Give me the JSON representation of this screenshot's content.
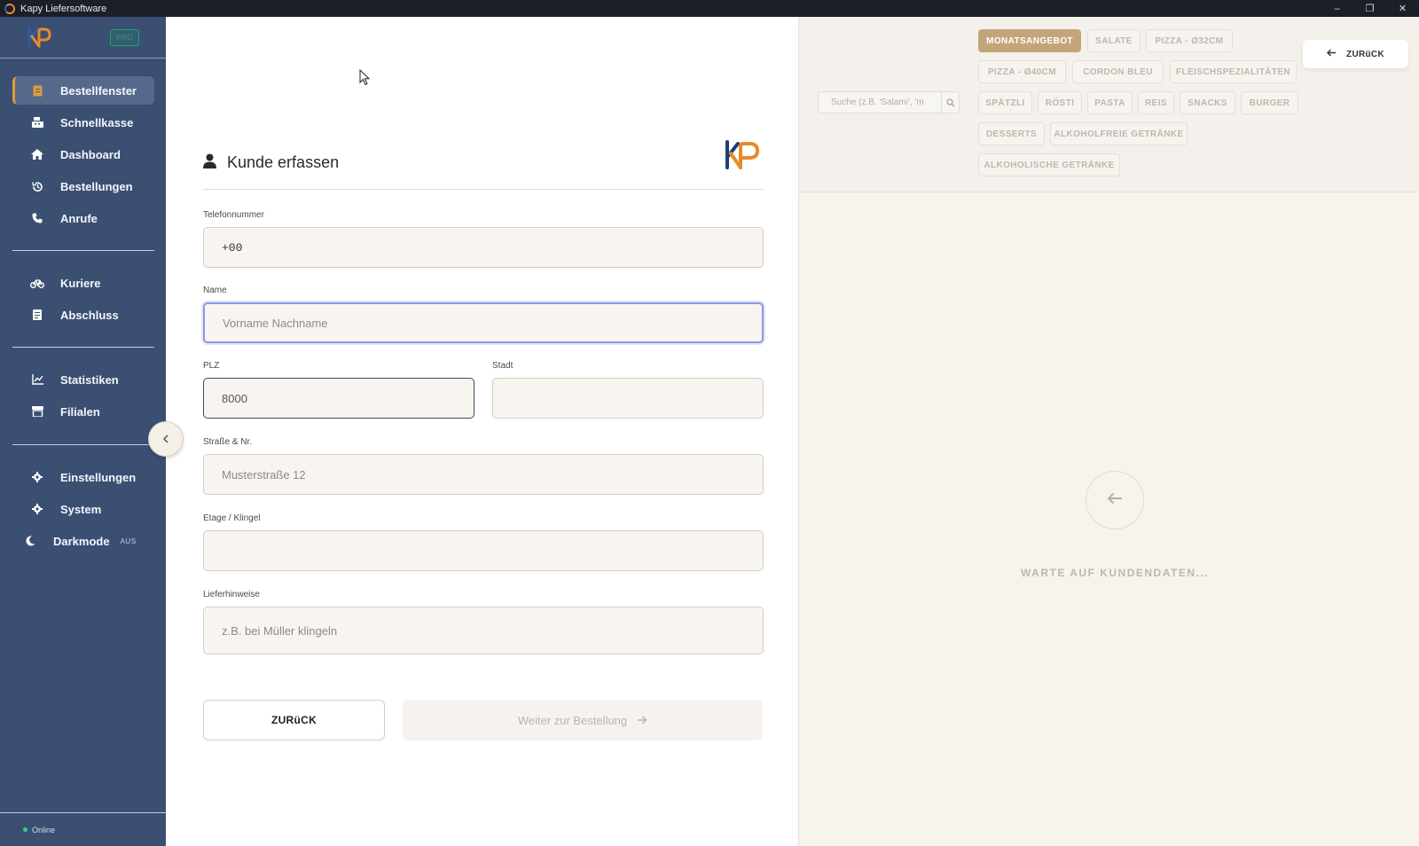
{
  "window": {
    "title": "Kapy Liefersoftware",
    "controls": [
      "–",
      "❐",
      "✕"
    ]
  },
  "sidebar": {
    "badge": "PRO",
    "items": [
      {
        "label": "Bestellfenster",
        "icon": "receipt-icon",
        "active": true
      },
      {
        "label": "Schnellkasse",
        "icon": "cash-register-icon"
      },
      {
        "label": "Dashboard",
        "icon": "home-icon"
      },
      {
        "label": "Bestellungen",
        "icon": "history-icon"
      },
      {
        "label": "Anrufe",
        "icon": "phone-icon"
      },
      {
        "label": "Kuriere",
        "icon": "bicycle-icon"
      },
      {
        "label": "Abschluss",
        "icon": "report-icon"
      },
      {
        "label": "Statistiken",
        "icon": "chart-line-icon"
      },
      {
        "label": "Filialen",
        "icon": "store-icon"
      },
      {
        "label": "Einstellungen",
        "icon": "gear-icon"
      },
      {
        "label": "System",
        "icon": "gear-icon"
      },
      {
        "label": "Darkmode",
        "icon": "moon-icon",
        "state": "AUS"
      }
    ],
    "status": "Online",
    "colors": {
      "background": "#3a4f72",
      "accent": "#e09a3a",
      "online": "#2bd67b"
    }
  },
  "form": {
    "title": "Kunde erfassen",
    "fields": {
      "phone": {
        "label": "Telefonnummer",
        "value": "+00"
      },
      "name": {
        "label": "Name",
        "placeholder": "Vorname Nachname"
      },
      "plz": {
        "label": "PLZ",
        "value": "8000"
      },
      "city": {
        "label": "Stadt",
        "value": ""
      },
      "street": {
        "label": "Straße & Nr.",
        "placeholder": "Musterstraße 12"
      },
      "floor": {
        "label": "Etage / Klingel",
        "value": ""
      },
      "notes": {
        "label": "Lieferhinweise",
        "placeholder": "z.B. bei Müller klingeln"
      }
    },
    "buttons": {
      "back": "ZURüCK",
      "next": "Weiter zur Bestellung"
    }
  },
  "menu": {
    "search_placeholder": "Suche (z.B. 'Salami', 'm",
    "categories": [
      "MONATSANGEBOT",
      "SALATE",
      "PIZZA - Ø32CM",
      "PIZZA - Ø40CM",
      "CORDON BLEU",
      "FLEISCHSPEZIALITÄTEN",
      "SPÄTZLI",
      "RÖSTI",
      "PASTA",
      "REIS",
      "SNACKS",
      "BURGER",
      "DESSERTS",
      "ALKOHOLFREIE GETRÄNKE",
      "ALKOHOLISCHE GETRÄNKE"
    ],
    "active_category": "MONATSANGEBOT",
    "back_button": "ZURüCK",
    "waiting_text": "WARTE AUF KUNDENDATEN...",
    "colors": {
      "active_category": "#c4a57a"
    }
  }
}
